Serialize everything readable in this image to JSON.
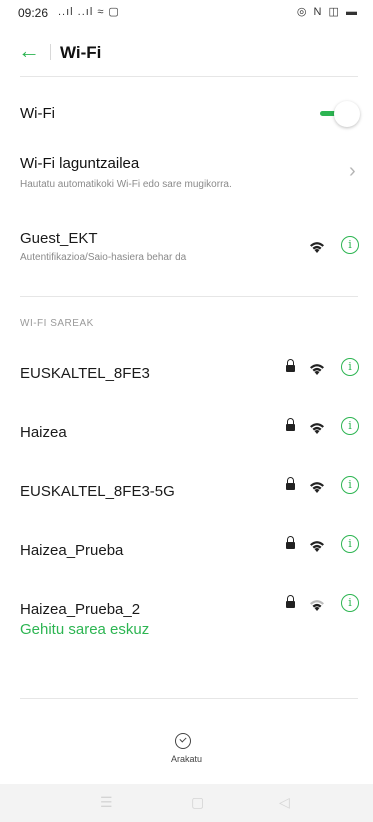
{
  "status_bar": {
    "time": "09:26",
    "left_icons": "..ıl ..ıl ≈ ▢",
    "right_icons": "◎ N ◫ ▬"
  },
  "header": {
    "back_icon": "←",
    "title": "Wi-Fi"
  },
  "wifi_toggle": {
    "label": "Wi-Fi",
    "enabled": true
  },
  "wifi_assistant": {
    "title": "Wi-Fi laguntzailea",
    "subtitle": "Hautatu automatikoki Wi-Fi edo sare mugikorra.",
    "chevron": "›"
  },
  "connected_network": {
    "name": "Guest_EKT",
    "status": "Autentifikazioa/Saio-hasiera behar da",
    "info_icon": "i"
  },
  "networks_section": {
    "header": "WI-FI SAREAK",
    "items": [
      {
        "name": "EUSKALTEL_8FE3",
        "secured": true,
        "info_icon": "i"
      },
      {
        "name": "Haizea",
        "secured": true,
        "info_icon": "i"
      },
      {
        "name": "EUSKALTEL_8FE3-5G",
        "secured": true,
        "info_icon": "i"
      },
      {
        "name": "Haizea_Prueba",
        "secured": true,
        "info_icon": "i"
      },
      {
        "name": "Haizea_Prueba_2",
        "secured": true,
        "info_icon": "i"
      }
    ]
  },
  "add_network_label": "Gehitu sarea eskuz",
  "bottom_tab": {
    "icon": "compass-icon",
    "label": "Arakatu"
  },
  "nav_bar": {
    "menu": "☰",
    "home": "▢",
    "back": "◁"
  },
  "colors": {
    "accent": "#2db552",
    "text": "#1a1a1a",
    "subtext": "#8a8a8a"
  }
}
